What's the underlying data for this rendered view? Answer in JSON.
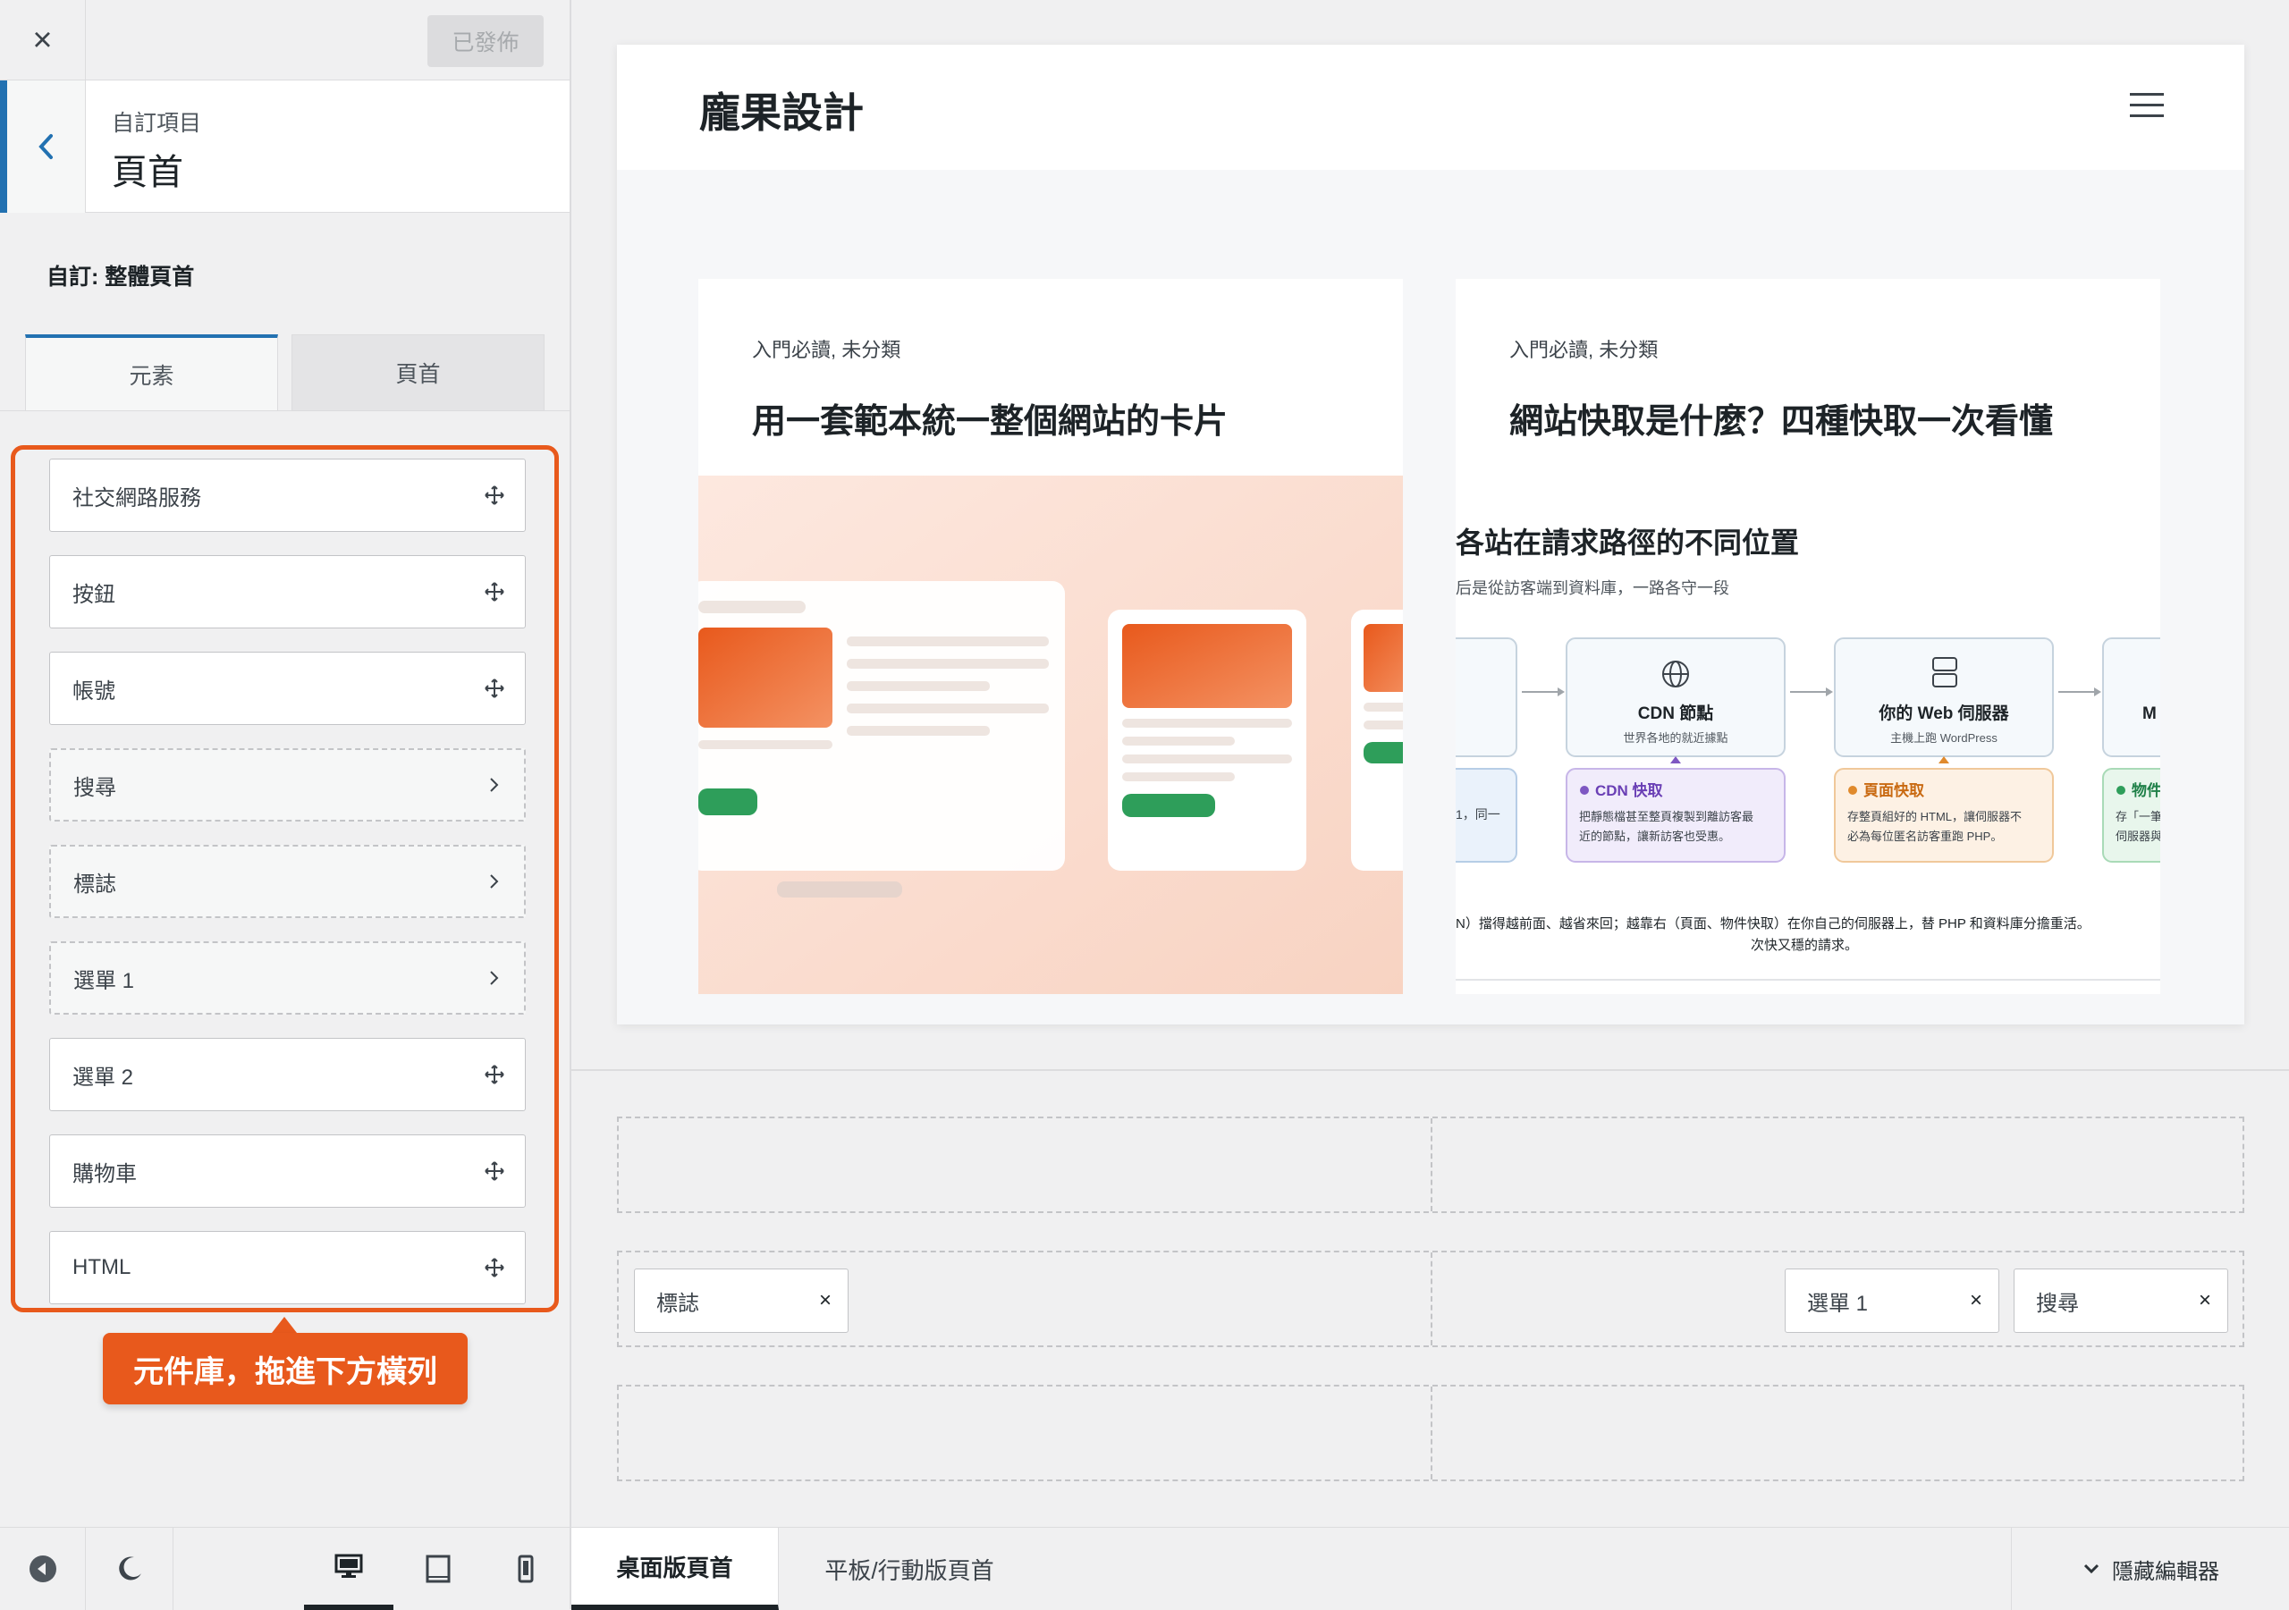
{
  "sidebar": {
    "close_icon": "×",
    "published_label": "已發佈",
    "breadcrumb": "自訂項目",
    "section_title": "頁首",
    "customize_label": "自訂: 整體頁首",
    "tabs": [
      "元素",
      "頁首"
    ],
    "items": [
      {
        "label": "社交網路服務",
        "icon": "move-icon"
      },
      {
        "label": "按鈕",
        "icon": "move-icon"
      },
      {
        "label": "帳號",
        "icon": "move-icon"
      },
      {
        "label": "搜尋",
        "icon": "chevron-right-icon"
      },
      {
        "label": "標誌",
        "icon": "chevron-right-icon"
      },
      {
        "label": "選單 1",
        "icon": "chevron-right-icon"
      },
      {
        "label": "選單 2",
        "icon": "move-icon"
      },
      {
        "label": "購物車",
        "icon": "move-icon"
      },
      {
        "label": "HTML",
        "icon": "move-icon"
      }
    ],
    "callout": "元件庫，拖進下方橫列"
  },
  "preview": {
    "site_title": "龐果設計",
    "cards": [
      {
        "category": "入門必讀, 未分類",
        "title": "用一套範本統一整個網站的卡片"
      },
      {
        "category": "入門必讀, 未分類",
        "title": "網站快取是什麼？四種快取一次看懂"
      }
    ],
    "diagram": {
      "heading": "各站在請求路徑的不同位置",
      "subheading": "后是從訪客端到資料庫，一路各守一段",
      "node_cdn": "CDN 節點",
      "node_cdn_sub": "世界各地的就近據點",
      "node_web": "你的 Web 伺服器",
      "node_web_sub": "主機上跑 WordPress",
      "node_m": "M",
      "cdn_cache": "CDN 快取",
      "cdn_cache_l1": "把靜態檔甚至整頁複製到離訪客最",
      "cdn_cache_l2": "近的節點，讓新訪客也受惠。",
      "page_cache": "頁面快取",
      "page_cache_l1": "存整頁組好的 HTML，讓伺服器不",
      "page_cache_l2": "必為每位匿名訪客重跑 PHP。",
      "obj_cache": "物件",
      "obj_l1": "存「一筆",
      "obj_l2": "伺服器與",
      "left_frag": "1，同一",
      "footer_l1": "N）擋得越前面、越省來回；越靠右（頁面、物件快取）在你自己的伺服器上，替 PHP 和資料庫分擔重活。",
      "footer_l2": "次快又穩的請求。"
    }
  },
  "builder": {
    "middle_left": [
      {
        "label": "標誌"
      }
    ],
    "middle_right": [
      {
        "label": "選單 1"
      },
      {
        "label": "搜尋"
      }
    ],
    "remove_icon": "×"
  },
  "bottom": {
    "tab_desktop": "桌面版頁首",
    "tab_tablet": "平板/行動版頁首",
    "hide_editor": "隱藏編輯器"
  },
  "colors": {
    "accent": "#2271b1",
    "highlight": "#e8591c"
  }
}
